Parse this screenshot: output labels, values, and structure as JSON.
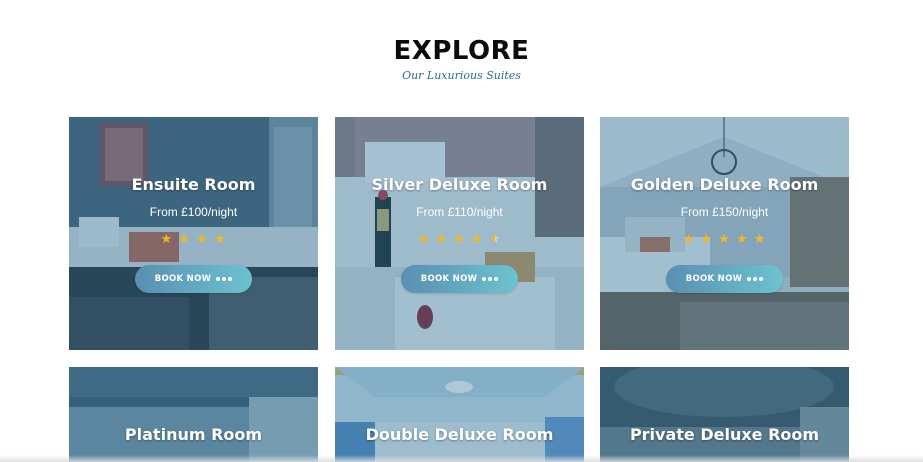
{
  "header": {
    "title": "EXPLORE",
    "subtitle": "Our Luxurious Suites"
  },
  "rooms": [
    {
      "name": "Ensuite Room",
      "price": "From £100/night",
      "rating": 4,
      "button": "BOOK NOW"
    },
    {
      "name": "Silver Deluxe Room",
      "price": "From £110/night",
      "rating": 4.5,
      "button": "BOOK NOW"
    },
    {
      "name": "Golden Deluxe Room",
      "price": "From £150/night",
      "rating": 5,
      "button": "BOOK NOW"
    },
    {
      "name": "Platinum Room",
      "price": "",
      "rating": null,
      "button": ""
    },
    {
      "name": "Double Deluxe Room",
      "price": "",
      "rating": null,
      "button": ""
    },
    {
      "name": "Private Deluxe Room",
      "price": "",
      "rating": null,
      "button": ""
    }
  ],
  "colors": {
    "accent": "#2a6f90",
    "star": "#f3b81f",
    "button_start": "#5a8fb2",
    "button_end": "#6cc2cf"
  },
  "icons": {
    "star": "star-icon",
    "more": "more-dots-icon"
  }
}
